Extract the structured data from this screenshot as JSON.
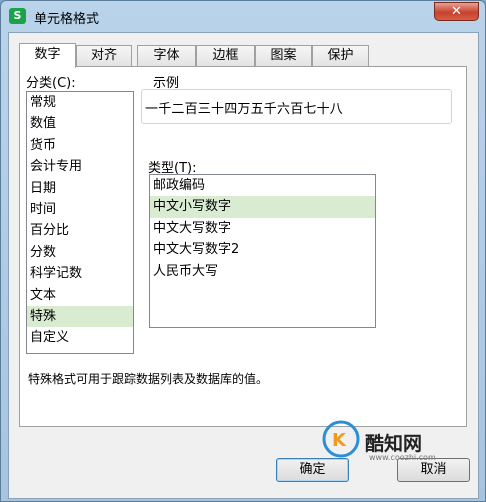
{
  "window": {
    "title": "单元格格式",
    "app_icon": "S",
    "close_glyph": "✕"
  },
  "tabs": [
    {
      "label": "数字",
      "active": true
    },
    {
      "label": "对齐"
    },
    {
      "label": "字体"
    },
    {
      "label": "边框"
    },
    {
      "label": "图案"
    },
    {
      "label": "保护"
    }
  ],
  "category": {
    "label": "分类(C):",
    "items": [
      "常规",
      "数值",
      "货币",
      "会计专用",
      "日期",
      "时间",
      "百分比",
      "分数",
      "科学记数",
      "文本",
      "特殊",
      "自定义"
    ],
    "selected": "特殊"
  },
  "sample": {
    "label": "示例",
    "value": "一千二百三十四万五千六百七十八"
  },
  "type": {
    "label": "类型(T):",
    "items": [
      "邮政编码",
      "中文小写数字",
      "中文大写数字",
      "中文大写数字2",
      "人民币大写"
    ],
    "selected": "中文小写数字"
  },
  "description": "特殊格式可用于跟踪数据列表及数据库的值。",
  "buttons": {
    "ok": "确定",
    "cancel": "取消"
  },
  "watermark": {
    "text": "酷知网",
    "url": "www.coozhi.com"
  }
}
